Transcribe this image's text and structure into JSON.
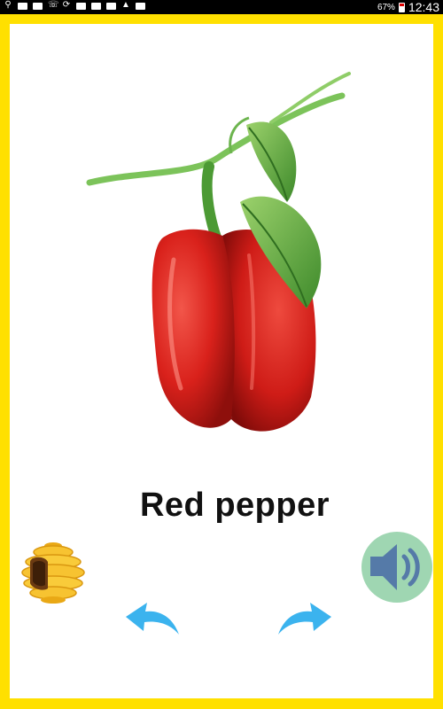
{
  "status_bar": {
    "battery": "67%",
    "time": "12:43",
    "left_icons": [
      "usb-icon",
      "message-icon",
      "image-icon",
      "missed-call-icon",
      "sync-icon",
      "download-icon",
      "youtube-icon",
      "youtube-icon",
      "warning-icon",
      "youtube-icon"
    ]
  },
  "flashcard": {
    "word": "Red pepper",
    "image": "red-bell-pepper"
  },
  "controls": {
    "home_icon": "beehive-icon",
    "sound_icon": "speaker-icon",
    "prev_icon": "arrow-back-icon",
    "next_icon": "arrow-forward-icon"
  },
  "colors": {
    "frame": "#FFE000",
    "card": "#FFFFFF",
    "arrow": "#3BB3EE",
    "sound_bg": "#9FD6B2",
    "pepper": "#D9211B"
  }
}
